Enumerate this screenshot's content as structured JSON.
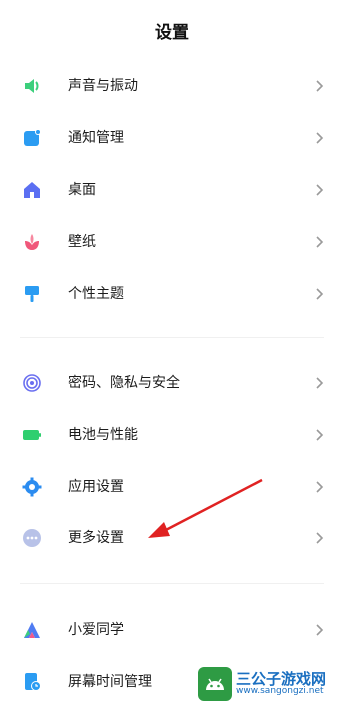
{
  "header": {
    "title": "设置"
  },
  "settings": {
    "group1": [
      {
        "label": "声音与振动",
        "icon": "speaker-icon",
        "color": "#3ccf7c"
      },
      {
        "label": "通知管理",
        "icon": "notification-icon",
        "color": "#2b9cf2"
      },
      {
        "label": "桌面",
        "icon": "home-icon",
        "color": "#5b6ff2"
      },
      {
        "label": "壁纸",
        "icon": "flower-icon",
        "color": "#f0577a"
      },
      {
        "label": "个性主题",
        "icon": "brush-icon",
        "color": "#2b9cf2"
      }
    ],
    "group2": [
      {
        "label": "密码、隐私与安全",
        "icon": "fingerprint-icon",
        "color": "#6a6ff0"
      },
      {
        "label": "电池与性能",
        "icon": "battery-icon",
        "color": "#2fcf6f"
      },
      {
        "label": "应用设置",
        "icon": "gear-icon",
        "color": "#2b8cf0"
      },
      {
        "label": "更多设置",
        "icon": "more-dots-icon",
        "color": "#8a9ad8"
      }
    ],
    "group3": [
      {
        "label": "小爱同学",
        "icon": "xiaoai-icon",
        "color": "#4f7cf2"
      },
      {
        "label": "屏幕时间管理",
        "icon": "screen-time-icon",
        "color": "#2b9cf2"
      }
    ]
  },
  "watermark": {
    "main": "三公子游戏网",
    "sub": "www.sangongzi.net"
  },
  "annotation": {
    "arrow_color": "#e02222"
  }
}
